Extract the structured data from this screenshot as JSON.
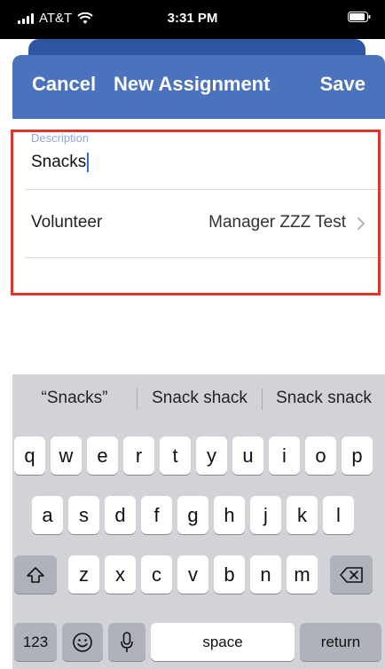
{
  "status_bar": {
    "carrier": "AT&T",
    "time": "3:31 PM"
  },
  "nav": {
    "cancel_label": "Cancel",
    "title": "New Assignment",
    "save_label": "Save"
  },
  "form": {
    "description_label": "Description",
    "description_value": "Snacks",
    "volunteer_label": "Volunteer",
    "volunteer_value": "Manager ZZZ Test"
  },
  "keyboard": {
    "suggestions": [
      "“Snacks”",
      "Snack shack",
      "Snack snack"
    ],
    "row1": [
      "q",
      "w",
      "e",
      "r",
      "t",
      "y",
      "u",
      "i",
      "o",
      "p"
    ],
    "row2": [
      "a",
      "s",
      "d",
      "f",
      "g",
      "h",
      "j",
      "k",
      "l"
    ],
    "row3": [
      "z",
      "x",
      "c",
      "v",
      "b",
      "n",
      "m"
    ],
    "numbers_label": "123",
    "space_label": "space",
    "return_label": "return"
  },
  "colors": {
    "nav_background": "#4a72bd",
    "sheet_tab": "#2e55a2",
    "highlight_border": "#e0362c",
    "keyboard_background": "#d1d3d9"
  }
}
